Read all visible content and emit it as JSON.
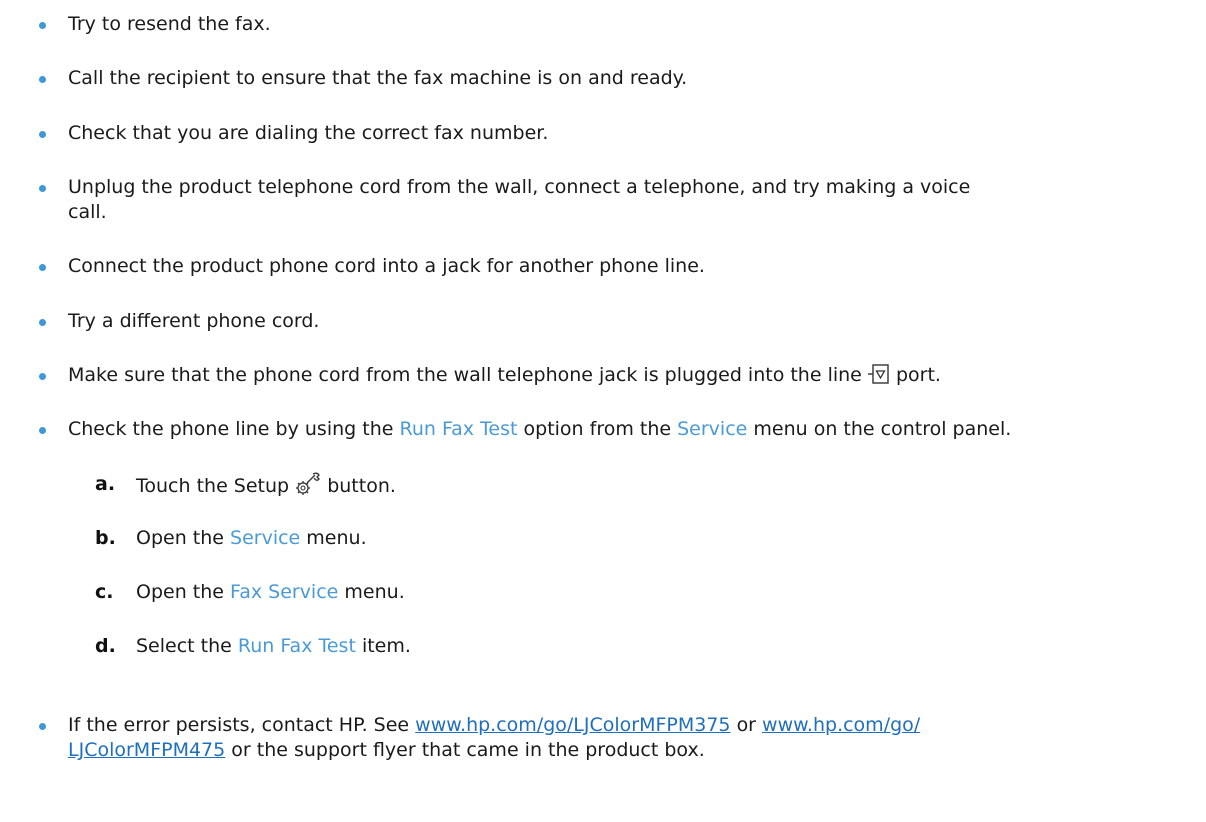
{
  "bullets": [
    {
      "text": "Try to resend the fax."
    },
    {
      "text": "Call the recipient to ensure that the fax machine is on and ready."
    },
    {
      "text": "Check that you are dialing the correct fax number."
    },
    {
      "line1": "Unplug the product telephone cord from the wall, connect a telephone, and try making a voice",
      "line2": "call."
    },
    {
      "text": "Connect the product phone cord into a jack for another phone line."
    },
    {
      "text": "Try a different phone cord."
    },
    {
      "before": "Make sure that the phone cord from the wall telephone jack is plugged into the line",
      "after": "port.",
      "icon": "phone-line-port-icon"
    },
    {
      "t1": "Check the phone line by using the",
      "k1": "Run Fax Test",
      "t2": "option from the",
      "k2": "Service",
      "t3": "menu on the control panel."
    },
    {
      "t1": "If the error persists, contact HP. See",
      "l1": "www.hp.com/go/LJColorMFPM375",
      "t2": "or",
      "l2a": "www.hp.com/go/",
      "l2b": "LJColorMFPM475",
      "t3": "or the support flyer that came in the product box."
    }
  ],
  "steps": [
    {
      "letter": "a.",
      "t1": "Touch the Setup",
      "icon": "setup-wrench-icon",
      "t2": "button."
    },
    {
      "letter": "b.",
      "t1": "Open the",
      "k": "Service",
      "t2": "menu."
    },
    {
      "letter": "c.",
      "t1": "Open the",
      "k": "Fax Service",
      "t2": "menu."
    },
    {
      "letter": "d.",
      "t1": "Select the",
      "k": "Run Fax Test",
      "t2": "item."
    }
  ],
  "colors": {
    "bullet": "#3f97d7",
    "accent": "#4a9ad6",
    "link": "#1f6fbf"
  }
}
